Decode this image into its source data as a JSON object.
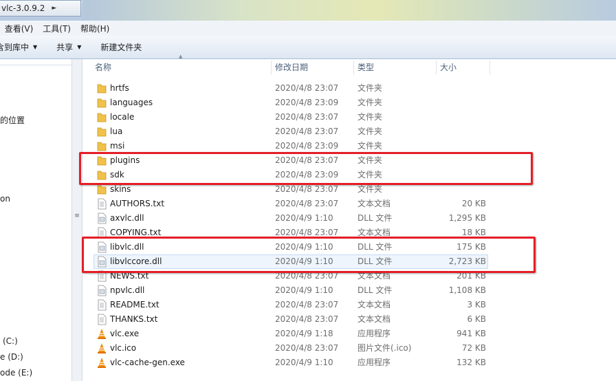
{
  "address": {
    "path": "vlc-3.0.9.2"
  },
  "menu": [
    {
      "label": ")"
    },
    {
      "label": "查看(V)"
    },
    {
      "label": "工具(T)"
    },
    {
      "label": "帮助(H)"
    }
  ],
  "toolbar": {
    "include_label": "含到库中",
    "share_label": "共享",
    "new_folder_label": "新建文件夹"
  },
  "nav": [
    {
      "label": "的位置"
    },
    {
      "label": "on"
    },
    {
      "label": "(C:)"
    },
    {
      "label": "e (D:)"
    },
    {
      "label": "ode (E:)"
    }
  ],
  "columns": {
    "name": "名称",
    "date": "修改日期",
    "type": "类型",
    "size": "大小"
  },
  "files": [
    {
      "name": "hrtfs",
      "date": "2020/4/8 23:07",
      "type": "文件夹",
      "size": "",
      "icon": "folder-icon"
    },
    {
      "name": "languages",
      "date": "2020/4/8 23:09",
      "type": "文件夹",
      "size": "",
      "icon": "folder-icon"
    },
    {
      "name": "locale",
      "date": "2020/4/8 23:07",
      "type": "文件夹",
      "size": "",
      "icon": "folder-icon"
    },
    {
      "name": "lua",
      "date": "2020/4/8 23:07",
      "type": "文件夹",
      "size": "",
      "icon": "folder-icon"
    },
    {
      "name": "msi",
      "date": "2020/4/8 23:09",
      "type": "文件夹",
      "size": "",
      "icon": "folder-icon"
    },
    {
      "name": "plugins",
      "date": "2020/4/8 23:07",
      "type": "文件夹",
      "size": "",
      "icon": "folder-icon"
    },
    {
      "name": "sdk",
      "date": "2020/4/8 23:09",
      "type": "文件夹",
      "size": "",
      "icon": "folder-icon"
    },
    {
      "name": "skins",
      "date": "2020/4/8 23:07",
      "type": "文件夹",
      "size": "",
      "icon": "folder-icon"
    },
    {
      "name": "AUTHORS.txt",
      "date": "2020/4/8 23:07",
      "type": "文本文档",
      "size": "20 KB",
      "icon": "text-file-icon"
    },
    {
      "name": "axvlc.dll",
      "date": "2020/4/9 1:10",
      "type": "DLL 文件",
      "size": "1,295 KB",
      "icon": "dll-file-icon"
    },
    {
      "name": "COPYING.txt",
      "date": "2020/4/8 23:07",
      "type": "文本文档",
      "size": "18 KB",
      "icon": "text-file-icon"
    },
    {
      "name": "libvlc.dll",
      "date": "2020/4/9 1:10",
      "type": "DLL 文件",
      "size": "175 KB",
      "icon": "dll-file-icon"
    },
    {
      "name": "libvlccore.dll",
      "date": "2020/4/9 1:10",
      "type": "DLL 文件",
      "size": "2,723 KB",
      "icon": "dll-file-icon",
      "selected": true
    },
    {
      "name": "NEWS.txt",
      "date": "2020/4/8 23:07",
      "type": "文本文档",
      "size": "201 KB",
      "icon": "text-file-icon"
    },
    {
      "name": "npvlc.dll",
      "date": "2020/4/9 1:10",
      "type": "DLL 文件",
      "size": "1,108 KB",
      "icon": "dll-file-icon"
    },
    {
      "name": "README.txt",
      "date": "2020/4/8 23:07",
      "type": "文本文档",
      "size": "3 KB",
      "icon": "text-file-icon"
    },
    {
      "name": "THANKS.txt",
      "date": "2020/4/8 23:07",
      "type": "文本文档",
      "size": "6 KB",
      "icon": "text-file-icon"
    },
    {
      "name": "vlc.exe",
      "date": "2020/4/9 1:18",
      "type": "应用程序",
      "size": "941 KB",
      "icon": "vlc-cone-icon"
    },
    {
      "name": "vlc.ico",
      "date": "2020/4/8 23:07",
      "type": "图片文件(.ico)",
      "size": "72 KB",
      "icon": "vlc-cone-icon"
    },
    {
      "name": "vlc-cache-gen.exe",
      "date": "2020/4/9 1:10",
      "type": "应用程序",
      "size": "132 KB",
      "icon": "vlc-cone-icon"
    }
  ],
  "colors": {
    "highlight": "#e41e26",
    "folder": "#f2c94c",
    "vlc": "#f08a00"
  }
}
